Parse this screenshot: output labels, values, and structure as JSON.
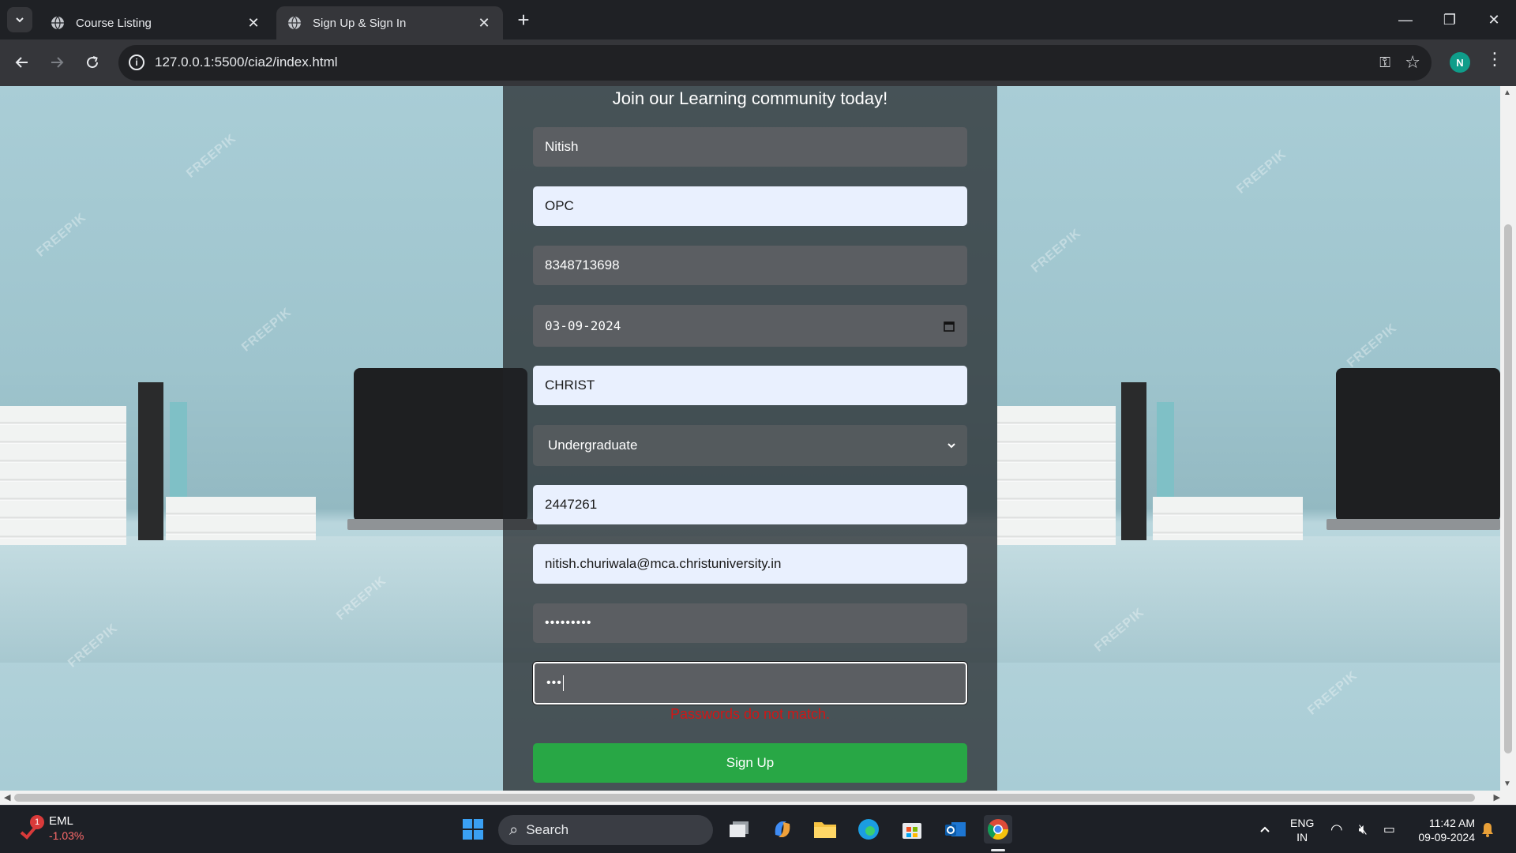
{
  "browser": {
    "tabs": [
      {
        "title": "Course Listing",
        "active": false
      },
      {
        "title": "Sign Up & Sign In",
        "active": true
      }
    ],
    "url": "127.0.0.1:5500/cia2/index.html",
    "profile_initial": "N"
  },
  "page": {
    "heading": "Join our Learning community today!",
    "fields": {
      "first_name": "Nitish",
      "last_name": "OPC",
      "phone": "8348713698",
      "dob": "03-09-2024",
      "institution": "CHRIST",
      "level_selected": "Undergraduate",
      "reg_number": "2447261",
      "email": "nitish.churiwala@mca.christuniversity.in",
      "password": "•••••••••",
      "confirm_password": "•••"
    },
    "error_message": "Passwords do not match.",
    "submit_label": "Sign Up",
    "watermark_text": "FREEPIK"
  },
  "taskbar": {
    "stock_name": "EML",
    "stock_change": "-1.03%",
    "stock_badge": "1",
    "search_label": "Search",
    "language": "ENG",
    "region": "IN",
    "time": "11:42 AM",
    "date": "09-09-2024"
  },
  "colors": {
    "signup_button": "#28a745",
    "error_text": "#d11616",
    "input_light": "#e9f0fe",
    "input_dark": "#5b5e62",
    "card_overlay": "rgba(32,34,37,0.72)"
  }
}
